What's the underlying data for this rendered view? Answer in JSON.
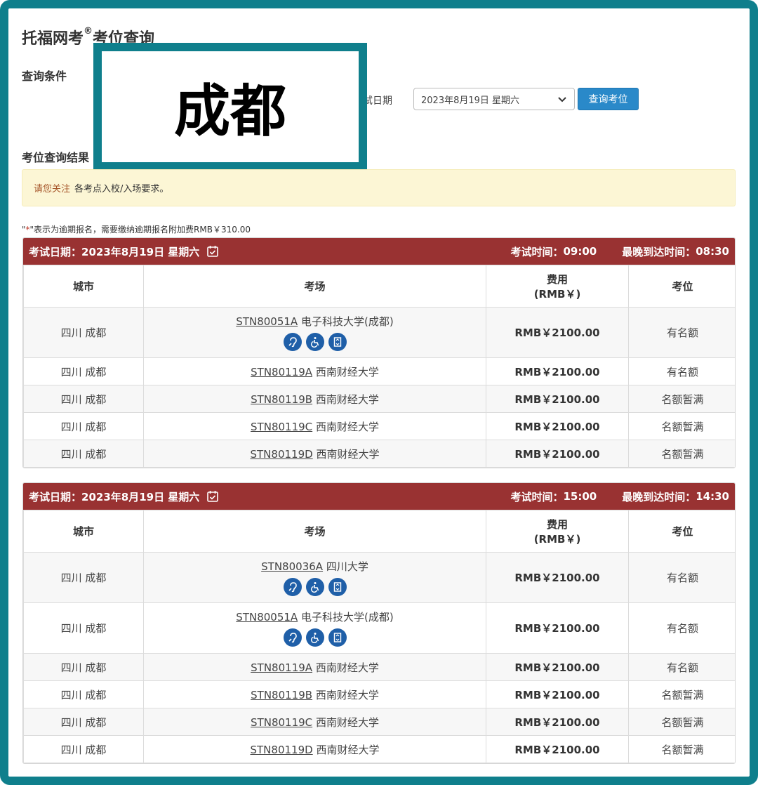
{
  "page_title": "托福网考",
  "page_title_sup": "®",
  "page_title_suffix": "考位查询",
  "query_heading": "查询条件",
  "date_label": "试日期",
  "date_select_value": "2023年8月19日 星期六",
  "query_button": "查询考位",
  "overlay_text": "成都",
  "results_heading": "考位查询结果",
  "notice": {
    "emphasis": "请您关注",
    "text": "各考点入校/入场要求。"
  },
  "footnote": {
    "quote_open": "\"",
    "star": "*",
    "text": "\"表示为逾期报名，需要缴纳逾期报名附加费RMB￥310.00"
  },
  "table_headers": {
    "city": "城市",
    "venue": "考场",
    "fee_line1": "费用",
    "fee_line2": "(RMB￥)",
    "seat": "考位"
  },
  "sessions": [
    {
      "date_label": "考试日期：",
      "date": "2023年8月19日 星期六",
      "time_label": "考试时间：",
      "time": "09:00",
      "arrive_label": "最晚到达时间：",
      "arrive": "08:30",
      "rows": [
        {
          "city": "四川 成都",
          "code": "STN80051A",
          "name": "电子科技大学(成都)",
          "fee": "RMB￥2100.00",
          "seat": "有名额",
          "icons": true
        },
        {
          "city": "四川 成都",
          "code": "STN80119A",
          "name": "西南财经大学",
          "fee": "RMB￥2100.00",
          "seat": "有名额",
          "icons": false
        },
        {
          "city": "四川 成都",
          "code": "STN80119B",
          "name": "西南财经大学",
          "fee": "RMB￥2100.00",
          "seat": "名额暂满",
          "icons": false
        },
        {
          "city": "四川 成都",
          "code": "STN80119C",
          "name": "西南财经大学",
          "fee": "RMB￥2100.00",
          "seat": "名额暂满",
          "icons": false
        },
        {
          "city": "四川 成都",
          "code": "STN80119D",
          "name": "西南财经大学",
          "fee": "RMB￥2100.00",
          "seat": "名额暂满",
          "icons": false
        }
      ]
    },
    {
      "date_label": "考试日期：",
      "date": "2023年8月19日 星期六",
      "time_label": "考试时间：",
      "time": "15:00",
      "arrive_label": "最晚到达时间：",
      "arrive": "14:30",
      "rows": [
        {
          "city": "四川 成都",
          "code": "STN80036A",
          "name": "四川大学",
          "fee": "RMB￥2100.00",
          "seat": "有名额",
          "icons": true
        },
        {
          "city": "四川 成都",
          "code": "STN80051A",
          "name": "电子科技大学(成都)",
          "fee": "RMB￥2100.00",
          "seat": "有名额",
          "icons": true
        },
        {
          "city": "四川 成都",
          "code": "STN80119A",
          "name": "西南财经大学",
          "fee": "RMB￥2100.00",
          "seat": "有名额",
          "icons": false
        },
        {
          "city": "四川 成都",
          "code": "STN80119B",
          "name": "西南财经大学",
          "fee": "RMB￥2100.00",
          "seat": "名额暂满",
          "icons": false
        },
        {
          "city": "四川 成都",
          "code": "STN80119C",
          "name": "西南财经大学",
          "fee": "RMB￥2100.00",
          "seat": "名额暂满",
          "icons": false
        },
        {
          "city": "四川 成都",
          "code": "STN80119D",
          "name": "西南财经大学",
          "fee": "RMB￥2100.00",
          "seat": "名额暂满",
          "icons": false
        }
      ]
    }
  ],
  "icon_names": [
    "hearing-support-icon",
    "wheelchair-access-icon",
    "elevator-icon"
  ],
  "colors": {
    "frame": "#0f7f8c",
    "header_bar": "#993232",
    "button": "#2a89c9",
    "notice_bg": "#fcf6d5",
    "icon_bg": "#1f5fa8"
  }
}
